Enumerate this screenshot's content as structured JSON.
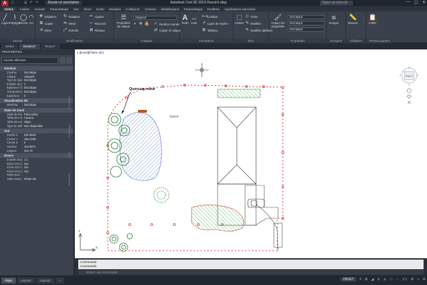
{
  "app": {
    "logo": "A",
    "title": "Autodesk Civil 3D 2019   Dessin1.dwg",
    "workspace": "Dessin et annotation",
    "search_placeholder": "Taper un mot-clé",
    "quick_access": [
      "▢",
      "🗁",
      "🖫",
      "↶",
      "↷"
    ],
    "window_controls": [
      "—",
      "▢",
      "✕"
    ]
  },
  "menu_tabs": [
    "Début",
    "Insérer",
    "Annoter",
    "Paramétrique",
    "Vue",
    "Gérer",
    "Sortie",
    "Modules",
    "Collaborer",
    "Création",
    "Modifications",
    "Paramétrique",
    "Fenêtres",
    "Applications associées"
  ],
  "ribbon": {
    "dessin": {
      "title": "Dessin",
      "tools": [
        "Ligne",
        "Polyligne",
        "Cercle",
        "Arc"
      ]
    },
    "modification": {
      "title": "Modification",
      "tools": [
        "Déplacer",
        "Rotation",
        "Ajuster",
        "Copier",
        "Miroir",
        "Raccord",
        "Etirer",
        "Echelle",
        "Réseau"
      ]
    },
    "calques": {
      "title": "Calques",
      "props_btn": "Propriétés du calque",
      "layer_value": "calquei2",
      "tools": [
        "Rendre courant",
        "Copier le calque"
      ]
    },
    "annotation": {
      "title": "Annotation",
      "text": "Texte",
      "cote": "Cote",
      "linear": "Linéaire",
      "mleader": "Ligne de repère",
      "table": "Tableau"
    },
    "bloc": {
      "title": "Bloc",
      "insert": "Insérer",
      "tools": [
        "Créer",
        "Modifier",
        "Modifier attributs"
      ]
    },
    "proprietes": {
      "title": "Propriétés",
      "copy_props": "Copier les propriétés",
      "color": "DuCalque",
      "linetype": "DuCalque",
      "lineweight": "DuCalque"
    },
    "groupes": {
      "title": "Groupes",
      "tool": "Groupe"
    },
    "utilitaires": {
      "title": "Utilitaires",
      "tool": "Mesure"
    },
    "presse": {
      "title": "Presse-papiers",
      "tool": "Coller"
    }
  },
  "file_tabs": [
    "Début",
    "Dessin1*",
    "Rues1*"
  ],
  "properties": {
    "title": "PROPRIÉTÉS",
    "selection": "Aucune sélection",
    "sections": [
      {
        "name": "Général",
        "rows": [
          [
            "Couleur",
            "DuCalque"
          ],
          [
            "Calque",
            "calquei2"
          ],
          [
            "Type de ligne",
            "DuCalque"
          ],
          [
            "Echelle du type de...",
            "1"
          ],
          [
            "Epaisseur de ligne",
            "DuCalque"
          ],
          [
            "Transparence",
            "DuCalque"
          ],
          [
            "Epaisseur",
            "0"
          ]
        ]
      },
      {
        "name": "Visualisation 3D",
        "rows": [
          [
            "Matériau",
            "DuCalque"
          ]
        ]
      },
      {
        "name": "Style de tracé",
        "rows": [
          [
            "Style de tracé",
            "ParCouleur"
          ],
          [
            "Table des styles d...",
            "Aucune"
          ],
          [
            "Table des tracés att...",
            "Objet"
          ],
          [
            "Type de table de tr...",
            "Non disponible"
          ]
        ]
      },
      {
        "name": "Vue",
        "rows": [
          [
            "Centre X",
            "231.6619"
          ],
          [
            "Centre Y",
            "156.2199"
          ],
          [
            "Centre Z",
            "0"
          ],
          [
            "Hauteur",
            "184.0871"
          ],
          [
            "Largeur",
            "312.75"
          ]
        ]
      },
      {
        "name": "Divers",
        "rows": [
          [
            "Echelle d'annotation",
            "1:1"
          ],
          [
            "Icône SCU activé",
            "Oui"
          ],
          [
            "Icône SCU au niveau...",
            "Oui"
          ],
          [
            "Icône SCU par fenêt...",
            "Oui"
          ],
          [
            "NOM SCU",
            ""
          ],
          [
            "Style visuel",
            "Filaire 2D"
          ]
        ]
      }
    ],
    "side_tabs": [
      "Géométrie",
      "Graphique",
      "Infos",
      "Propriétés"
    ]
  },
  "drawing": {
    "view_label": "[–][Haut][Filaire 2D]",
    "tree_label": "Quercus robur",
    "lawn_label": "Gazon",
    "viewcube_face": "HAUT",
    "viewcube_dirs": [
      "N",
      "O",
      "E",
      "S"
    ]
  },
  "command": {
    "history": [
      "Commande:",
      "Commande:"
    ],
    "placeholder": "Entrez une commande"
  },
  "status": {
    "layout_tabs": [
      "Objet",
      "Layout1",
      "Layout2",
      "+"
    ],
    "model": "OBJET",
    "icons": [
      "#",
      "⊞",
      "◢",
      "⊙",
      "∠",
      "□",
      "⋯",
      "1:1",
      "⚙",
      "+",
      "☰"
    ]
  }
}
